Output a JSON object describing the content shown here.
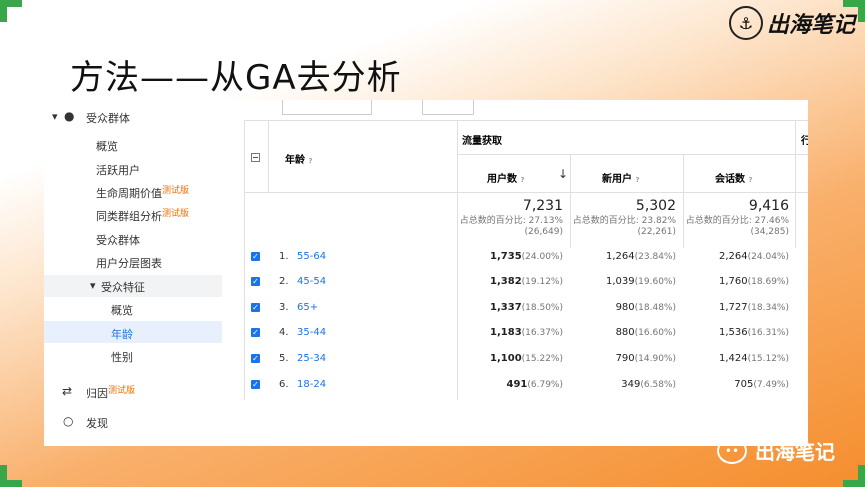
{
  "slide": {
    "title": "方法——从GA去分析",
    "logo_text": "出海笔记",
    "logo_icon": "anchor-icon",
    "watermark_text": "出海笔记",
    "watermark_icon": "wechat-icon"
  },
  "sidebar": {
    "section": "受众群体",
    "items": [
      {
        "label": "概览"
      },
      {
        "label": "活跃用户"
      },
      {
        "label": "生命周期价值",
        "badge": "测试版"
      },
      {
        "label": "同类群组分析",
        "badge": "测试版"
      },
      {
        "label": "受众群体"
      },
      {
        "label": "用户分层图表"
      },
      {
        "label": "受众特征"
      },
      {
        "label": "概览"
      },
      {
        "label": "年龄"
      },
      {
        "label": "性别"
      }
    ],
    "bottom": [
      {
        "label": "归因",
        "badge": "测试版"
      },
      {
        "label": "发现"
      }
    ]
  },
  "table": {
    "dimension_header": "年龄",
    "group_header": "流量获取",
    "cut_header": "行",
    "columns": [
      "用户数",
      "新用户",
      "会话数"
    ],
    "totals": [
      {
        "value": "7,231",
        "line1": "占总数的百分比: 27.13%",
        "line2": "(26,649)"
      },
      {
        "value": "5,302",
        "line1": "占总数的百分比: 23.82%",
        "line2": "(22,261)"
      },
      {
        "value": "9,416",
        "line1": "占总数的百分比: 27.46%",
        "line2": "(34,285)"
      }
    ],
    "rows": [
      {
        "num": "1.",
        "label": "55-64",
        "users": "1,735",
        "users_pct": "(24.00%)",
        "new": "1,264",
        "new_pct": "(23.84%)",
        "sess": "2,264",
        "sess_pct": "(24.04%)"
      },
      {
        "num": "2.",
        "label": "45-54",
        "users": "1,382",
        "users_pct": "(19.12%)",
        "new": "1,039",
        "new_pct": "(19.60%)",
        "sess": "1,760",
        "sess_pct": "(18.69%)"
      },
      {
        "num": "3.",
        "label": "65+",
        "users": "1,337",
        "users_pct": "(18.50%)",
        "new": "980",
        "new_pct": "(18.48%)",
        "sess": "1,727",
        "sess_pct": "(18.34%)"
      },
      {
        "num": "4.",
        "label": "35-44",
        "users": "1,183",
        "users_pct": "(16.37%)",
        "new": "880",
        "new_pct": "(16.60%)",
        "sess": "1,536",
        "sess_pct": "(16.31%)"
      },
      {
        "num": "5.",
        "label": "25-34",
        "users": "1,100",
        "users_pct": "(15.22%)",
        "new": "790",
        "new_pct": "(14.90%)",
        "sess": "1,424",
        "sess_pct": "(15.12%)"
      },
      {
        "num": "6.",
        "label": "18-24",
        "users": "491",
        "users_pct": "(6.79%)",
        "new": "349",
        "new_pct": "(6.58%)",
        "sess": "705",
        "sess_pct": "(7.49%)"
      }
    ]
  },
  "colors": {
    "accent": "#1a73e8",
    "beta": "#e8710a",
    "orange": "#f58e2e",
    "green": "#3aa64a"
  }
}
